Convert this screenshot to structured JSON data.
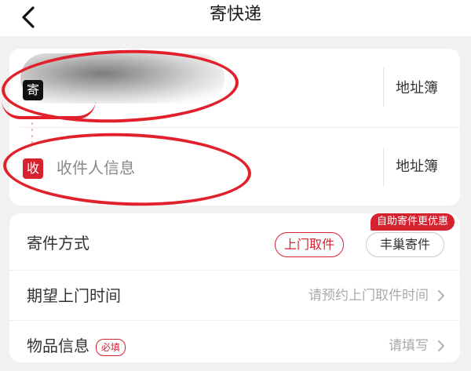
{
  "header": {
    "title": "寄快递"
  },
  "sender": {
    "tag": "寄",
    "address_book_label": "地址簿"
  },
  "receiver": {
    "tag": "收",
    "placeholder": "收件人信息",
    "address_book_label": "地址簿"
  },
  "options": {
    "method": {
      "label": "寄件方式",
      "door_pickup_label": "上门取件",
      "station_label": "丰巢寄件",
      "promo_badge": "自助寄件更优惠"
    },
    "pickup_time": {
      "label": "期望上门时间",
      "placeholder": "请预约上门取件时间"
    },
    "item_info": {
      "label": "物品信息",
      "required_badge": "必填",
      "placeholder": "请填写"
    }
  },
  "colors": {
    "accent": "#d6212f",
    "annotation": "#e2202b"
  },
  "icons": {
    "back": "chevron-left-icon",
    "row_arrow": "chevron-right-icon"
  }
}
